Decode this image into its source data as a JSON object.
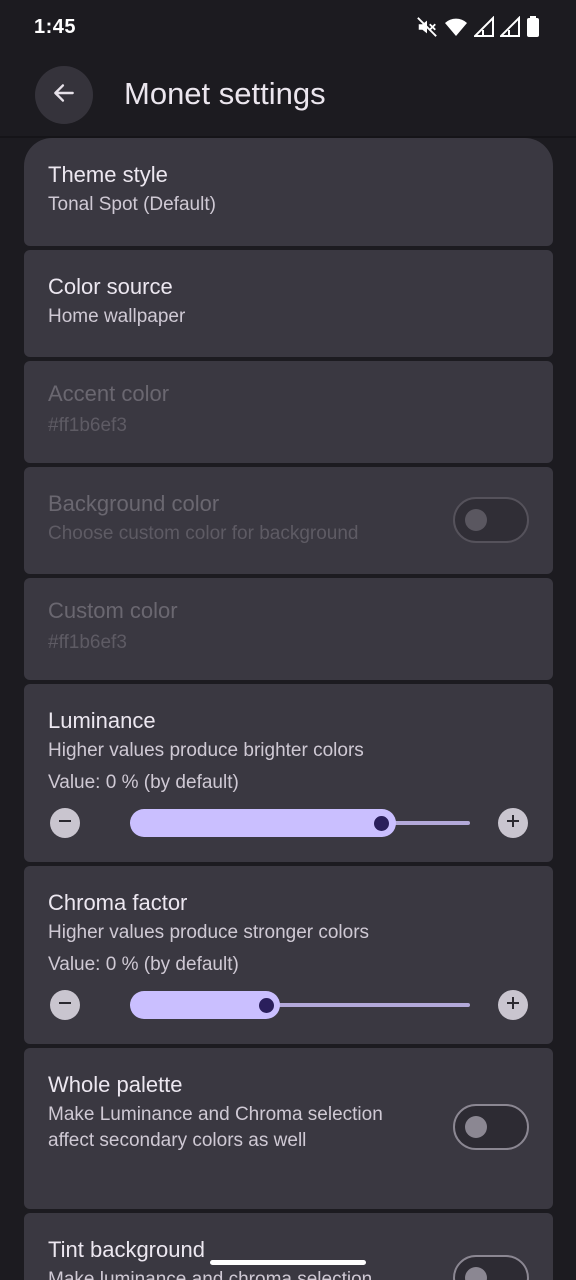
{
  "status_bar": {
    "time": "1:45",
    "icons": [
      "mute-icon",
      "wifi-icon",
      "signal-icon",
      "signal-icon",
      "battery-icon"
    ]
  },
  "app_bar": {
    "title": "Monet settings",
    "back_icon": "arrow-back-icon"
  },
  "settings": {
    "theme_style": {
      "title": "Theme style",
      "summary": "Tonal Spot (Default)"
    },
    "color_source": {
      "title": "Color source",
      "summary": "Home wallpaper"
    },
    "accent_color": {
      "title": "Accent color",
      "summary": "#ff1b6ef3",
      "enabled": false
    },
    "background_color": {
      "title": "Background color",
      "summary": "Choose custom color for background",
      "enabled": false,
      "checked": false
    },
    "custom_color": {
      "title": "Custom color",
      "summary": "#ff1b6ef3",
      "enabled": false
    },
    "luminance": {
      "title": "Luminance",
      "summary": "Higher values produce brighter colors",
      "value_text": "Value: 0 % (by default)",
      "fraction": 0.74
    },
    "chroma_factor": {
      "title": "Chroma factor",
      "summary": "Higher values produce stronger colors",
      "value_text": "Value: 0 % (by default)",
      "fraction": 0.4
    },
    "whole_palette": {
      "title": "Whole palette",
      "summary": "Make Luminance and Chroma selection affect secondary colors as well",
      "checked": false
    },
    "tint_background": {
      "title": "Tint background",
      "summary": "Make luminance and chroma selection",
      "checked": false
    }
  },
  "colors": {
    "background": "#1c1b20",
    "card": "#3a3841",
    "slider_active": "#cabfff",
    "slider_thumb": "#2a1f5c"
  }
}
